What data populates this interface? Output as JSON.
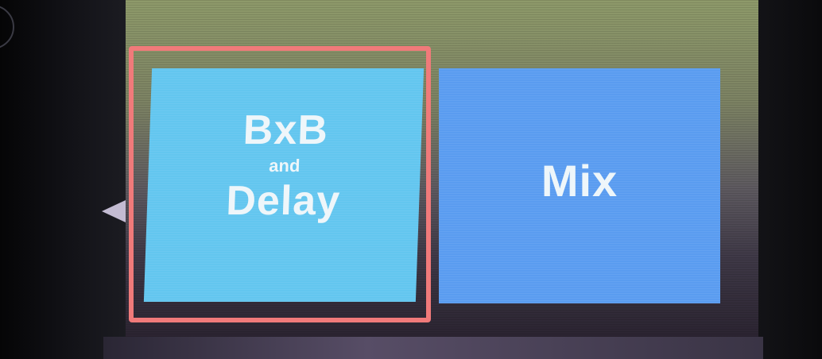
{
  "screen": {
    "tiles": [
      {
        "id": "bxb-delay",
        "label_line1": "BxB",
        "label_line2": "and",
        "label_line3": "Delay",
        "color": "#63c6ef",
        "selected": true
      },
      {
        "id": "mix",
        "label": "Mix",
        "color": "#5a9cf0",
        "selected": false
      }
    ]
  },
  "colors": {
    "selection": "#f07a7a",
    "tile_text": "#eef6fa",
    "bezel": "#0a0a0c"
  },
  "icons": {
    "bezel_knob": "knob-ring-icon",
    "bezel_pointer": "pointer-triangle-icon"
  }
}
